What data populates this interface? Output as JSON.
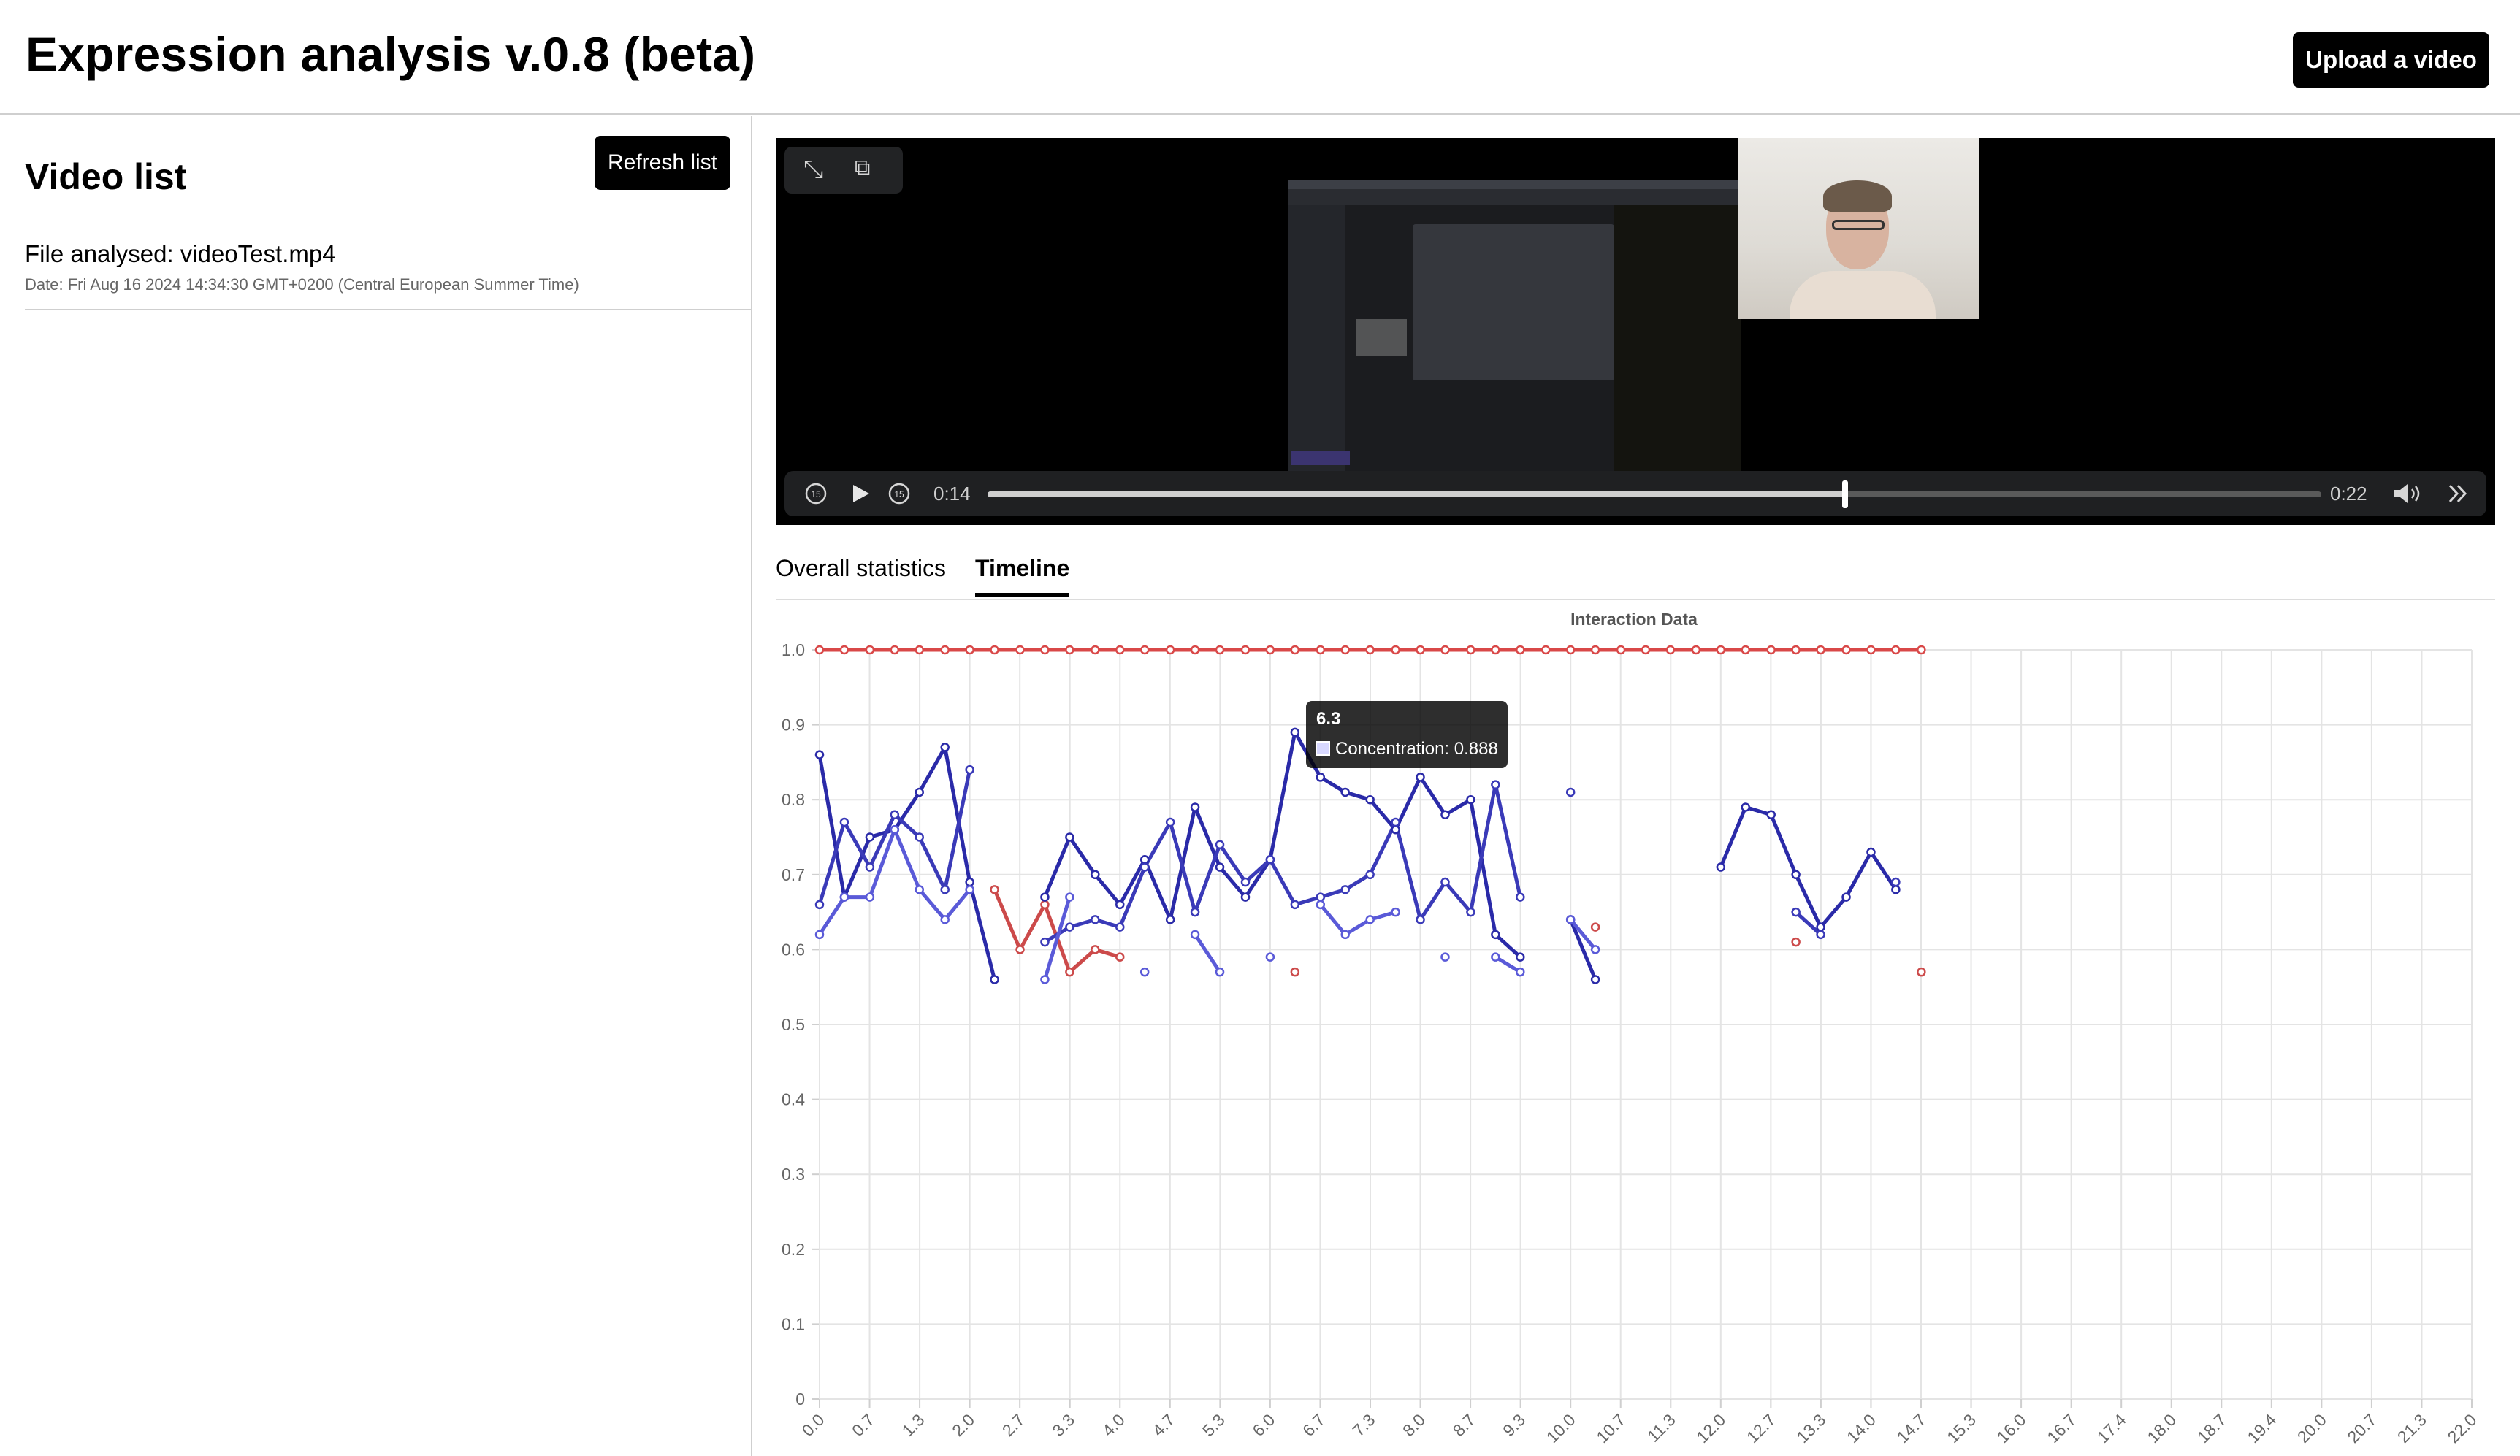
{
  "app": {
    "title": "Expression analysis v.0.8 (beta)",
    "upload_label": "Upload a video"
  },
  "sidebar": {
    "title": "Video list",
    "refresh_label": "Refresh list",
    "files": [
      {
        "name": "File analysed: videoTest.mp4",
        "date": "Date: Fri Aug 16 2024 14:34:30 GMT+0200 (Central European Summer Time)"
      }
    ]
  },
  "video": {
    "current_time": "0:14",
    "duration": "0:22",
    "progress": 0.643,
    "icons": {
      "fullscreen": "expand-icon",
      "pip": "picture-in-picture-icon",
      "rewind": "skip-back-15-icon",
      "play": "play-icon",
      "forward": "skip-forward-15-icon",
      "volume": "volume-icon",
      "more": "chevron-double-right-icon"
    }
  },
  "tabs": [
    {
      "label": "Overall statistics",
      "active": false
    },
    {
      "label": "Timeline",
      "active": true
    }
  ],
  "tooltip": {
    "title": "6.3",
    "label": "Concentration: 0.888"
  },
  "chart_data": {
    "type": "line",
    "title": "Interaction Data",
    "xlabel": "",
    "ylabel": "",
    "ylim": [
      0,
      1
    ],
    "yticks": [
      "0",
      "0.1",
      "0.2",
      "0.3",
      "0.4",
      "0.5",
      "0.6",
      "0.7",
      "0.8",
      "0.9",
      "1.0"
    ],
    "xticks": [
      "0.0",
      "0.7",
      "1.3",
      "2.0",
      "2.7",
      "3.3",
      "4.0",
      "4.7",
      "5.3",
      "6.0",
      "6.7",
      "7.3",
      "8.0",
      "8.7",
      "9.3",
      "10.0",
      "10.7",
      "11.3",
      "12.0",
      "12.7",
      "13.3",
      "14.0",
      "14.7",
      "15.3",
      "16.0",
      "16.7",
      "17.4",
      "18.0",
      "18.7",
      "19.4",
      "20.0",
      "20.7",
      "21.3",
      "22.0"
    ],
    "grid": true,
    "x": [
      0.0,
      0.33,
      0.67,
      1.0,
      1.33,
      1.67,
      2.0,
      2.33,
      2.67,
      3.0,
      3.33,
      3.67,
      4.0,
      4.33,
      4.67,
      5.0,
      5.33,
      5.67,
      6.0,
      6.33,
      6.67,
      7.0,
      7.33,
      7.67,
      8.0,
      8.33,
      8.67,
      9.0,
      9.33,
      9.67,
      10.0,
      10.33,
      10.67,
      11.0,
      11.33,
      11.67,
      12.0,
      12.33,
      12.67,
      13.0,
      13.33,
      13.67,
      14.0,
      14.33,
      14.67
    ],
    "series": [
      {
        "color": "#d94848",
        "values": [
          1.0,
          1.0,
          1.0,
          1.0,
          1.0,
          1.0,
          1.0,
          1.0,
          1.0,
          1.0,
          1.0,
          1.0,
          1.0,
          1.0,
          1.0,
          1.0,
          1.0,
          1.0,
          1.0,
          1.0,
          1.0,
          1.0,
          1.0,
          1.0,
          1.0,
          1.0,
          1.0,
          1.0,
          1.0,
          1.0,
          1.0,
          1.0,
          1.0,
          1.0,
          1.0,
          1.0,
          1.0,
          1.0,
          1.0,
          1.0,
          1.0,
          1.0,
          1.0,
          1.0,
          1.0
        ]
      },
      {
        "color": "#cc4a4a",
        "values": [
          null,
          null,
          null,
          null,
          null,
          null,
          null,
          0.68,
          0.6,
          0.66,
          0.57,
          0.6,
          0.59,
          null,
          null,
          null,
          null,
          null,
          null,
          0.57,
          null,
          null,
          null,
          null,
          null,
          null,
          null,
          null,
          null,
          null,
          null,
          0.63,
          null,
          null,
          null,
          null,
          null,
          null,
          null,
          0.61,
          null,
          null,
          null,
          null,
          0.57
        ]
      },
      {
        "color": "#2a2aa8",
        "values": [
          0.86,
          0.67,
          0.75,
          0.76,
          0.81,
          0.87,
          0.69,
          0.56,
          null,
          0.67,
          0.75,
          0.7,
          0.66,
          0.72,
          0.64,
          0.79,
          0.71,
          0.67,
          0.72,
          0.89,
          0.83,
          0.81,
          0.8,
          0.76,
          0.83,
          0.78,
          0.8,
          0.62,
          0.59,
          null,
          0.64,
          0.56,
          null,
          null,
          null,
          null,
          0.71,
          0.79,
          0.78,
          0.7,
          0.63,
          0.67,
          0.73,
          0.68,
          null
        ]
      },
      {
        "color": "#3a3ab8",
        "values": [
          0.66,
          0.77,
          0.71,
          0.78,
          0.75,
          0.68,
          0.84,
          null,
          null,
          0.61,
          0.63,
          0.64,
          0.63,
          0.71,
          0.77,
          0.65,
          0.74,
          0.69,
          0.72,
          0.66,
          0.67,
          0.68,
          0.7,
          0.77,
          0.64,
          0.69,
          0.65,
          0.82,
          0.67,
          null,
          0.81,
          null,
          null,
          null,
          null,
          null,
          null,
          null,
          null,
          0.65,
          0.62,
          null,
          null,
          0.69,
          null
        ]
      },
      {
        "color": "#5a5ad8",
        "values": [
          0.62,
          0.67,
          0.67,
          0.76,
          0.68,
          0.64,
          0.68,
          null,
          null,
          0.56,
          0.67,
          null,
          null,
          0.57,
          null,
          0.62,
          0.57,
          null,
          0.59,
          null,
          0.66,
          0.62,
          0.64,
          0.65,
          null,
          0.59,
          null,
          0.59,
          0.57,
          null,
          0.64,
          0.6,
          null,
          null,
          null,
          null,
          null,
          null,
          null,
          null,
          null,
          null,
          null,
          null,
          null
        ]
      }
    ]
  }
}
